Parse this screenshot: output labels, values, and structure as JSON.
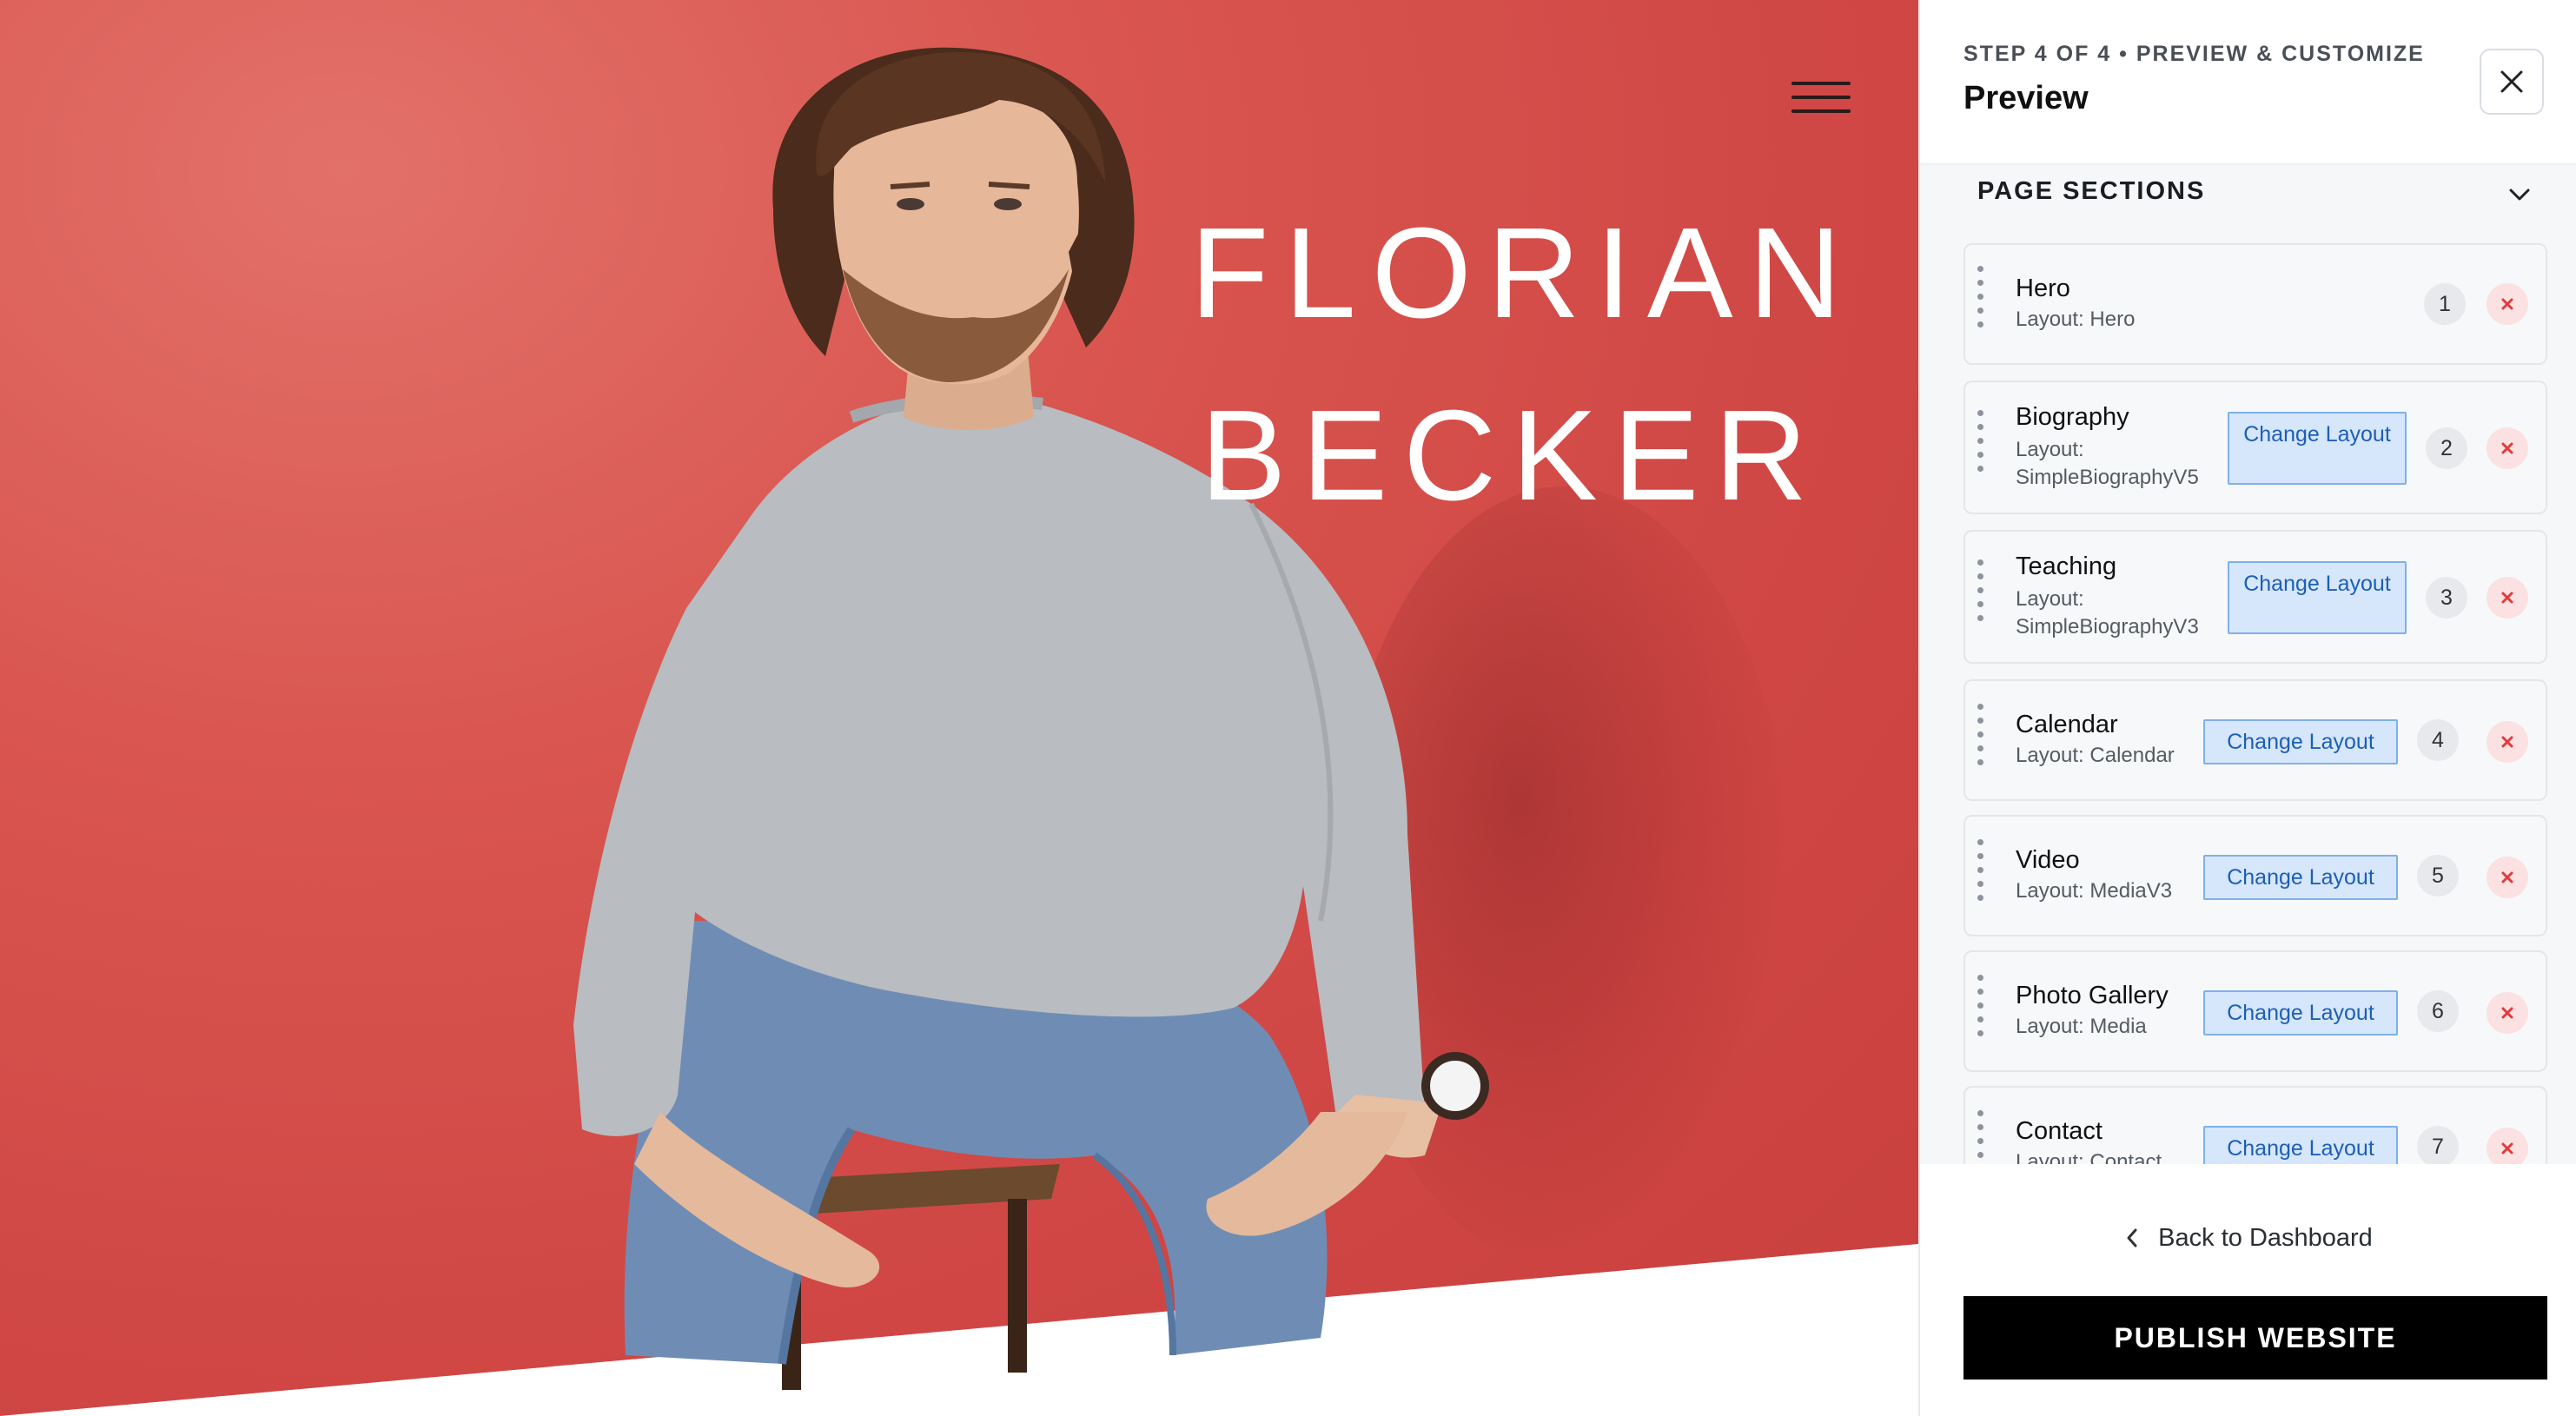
{
  "hero": {
    "first_name": "FLORIAN",
    "last_name": "BECKER",
    "background_color": "#d34b48",
    "menu_icon": "hamburger-menu-icon"
  },
  "panel": {
    "step_label": "STEP 4 OF 4 • PREVIEW & CUSTOMIZE",
    "title": "Preview",
    "close_icon": "close-icon",
    "sections_title": "PAGE SECTIONS",
    "sections_toggle_icon": "chevron-down-icon",
    "sections": [
      {
        "name": "Hero",
        "layout_prefix": "Layout:",
        "layout": "Hero",
        "number": "1",
        "change_label": ""
      },
      {
        "name": "Biography",
        "layout_prefix": "Layout:",
        "layout": "SimpleBiographyV5",
        "number": "2",
        "change_label": "Change Layout"
      },
      {
        "name": "Teaching",
        "layout_prefix": "Layout:",
        "layout": "SimpleBiographyV3",
        "number": "3",
        "change_label": "Change Layout"
      },
      {
        "name": "Calendar",
        "layout_prefix": "Layout:",
        "layout": "Calendar",
        "number": "4",
        "change_label": "Change Layout"
      },
      {
        "name": "Video",
        "layout_prefix": "Layout:",
        "layout": "MediaV3",
        "number": "5",
        "change_label": "Change Layout"
      },
      {
        "name": "Photo Gallery",
        "layout_prefix": "Layout:",
        "layout": "Media",
        "number": "6",
        "change_label": "Change Layout"
      },
      {
        "name": "Contact",
        "layout_prefix": "Layout:",
        "layout": "Contact",
        "number": "7",
        "change_label": "Change Layout"
      }
    ],
    "remove_icon": "remove-x-icon",
    "drag_icon": "drag-handle-icon",
    "back_label": "Back to Dashboard",
    "back_icon": "chevron-left-icon",
    "publish_label": "PUBLISH WEBSITE",
    "accent_color": "#1d5fb6",
    "danger_color": "#e23b3b"
  }
}
